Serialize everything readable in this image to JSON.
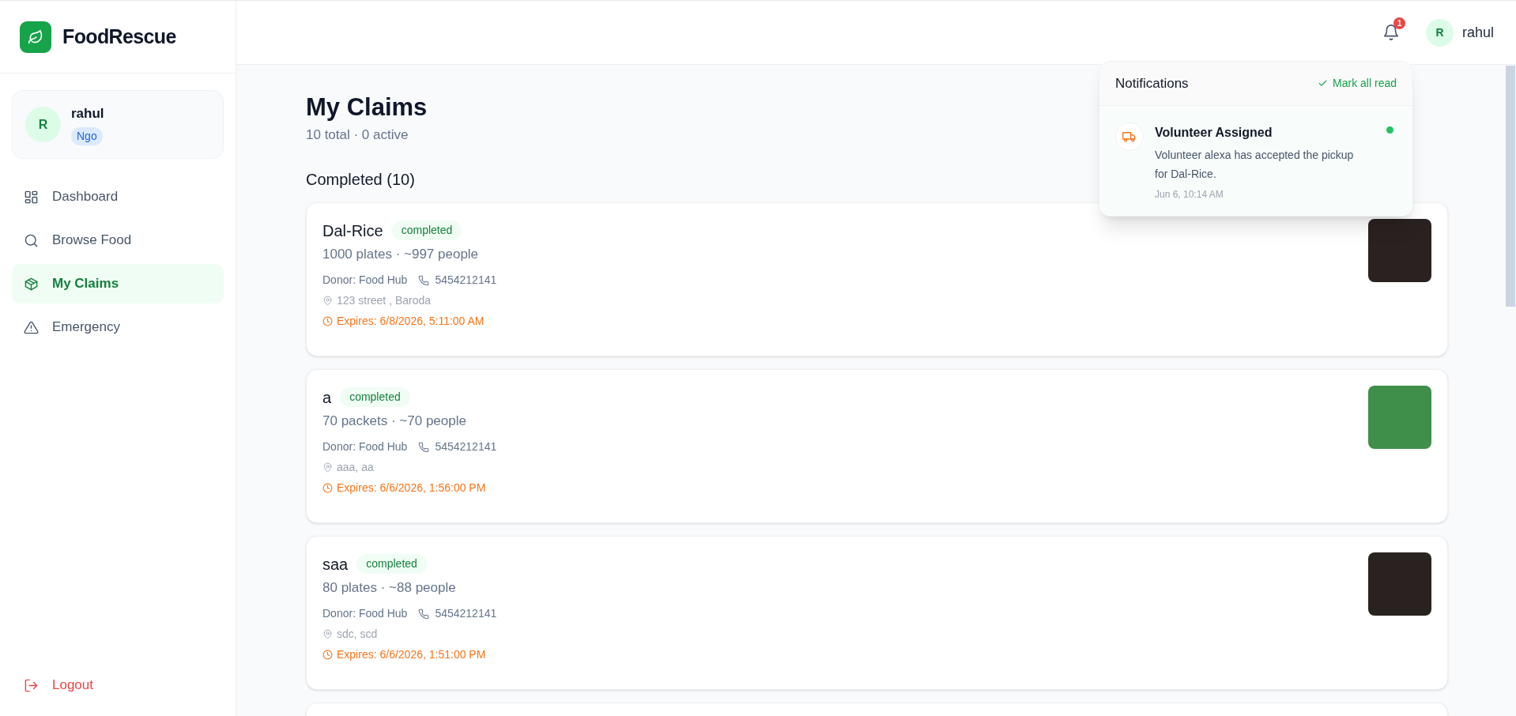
{
  "brand": {
    "name": "FoodRescue"
  },
  "user_card": {
    "initial": "R",
    "name": "rahul",
    "role": "Ngo"
  },
  "sidebar": {
    "items": [
      {
        "label": "Dashboard",
        "selected": false
      },
      {
        "label": "Browse Food",
        "selected": false
      },
      {
        "label": "My Claims",
        "selected": true
      },
      {
        "label": "Emergency",
        "selected": false
      }
    ],
    "logout": "Logout"
  },
  "header": {
    "notification_count": "1",
    "user_initial": "R",
    "user_name": "rahul"
  },
  "page": {
    "title": "My Claims",
    "subtitle": "10 total · 0 active",
    "section": "Completed (10)"
  },
  "claims": [
    {
      "title": "Dal-Rice",
      "status": "completed",
      "quantity": "1000 plates · ~997 people",
      "donor": "Donor: Food Hub",
      "phone": "5454212141",
      "address": "123 street , Baroda",
      "expires": "Expires: 6/8/2026, 5:11:00 AM"
    },
    {
      "title": "a",
      "status": "completed",
      "quantity": "70 packets · ~70 people",
      "donor": "Donor: Food Hub",
      "phone": "5454212141",
      "address": "aaa, aa",
      "expires": "Expires: 6/6/2026, 1:56:00 PM"
    },
    {
      "title": "saa",
      "status": "completed",
      "quantity": "80 plates · ~88 people",
      "donor": "Donor: Food Hub",
      "phone": "5454212141",
      "address": "sdc, scd",
      "expires": "Expires: 6/6/2026, 1:51:00 PM"
    }
  ],
  "notifications": {
    "title": "Notifications",
    "mark_all": "Mark all read",
    "items": [
      {
        "title": "Volunteer Assigned",
        "body": "Volunteer alexa has accepted the pickup for Dal-Rice.",
        "time": "Jun 6, 10:14 AM",
        "unread": true
      }
    ]
  }
}
